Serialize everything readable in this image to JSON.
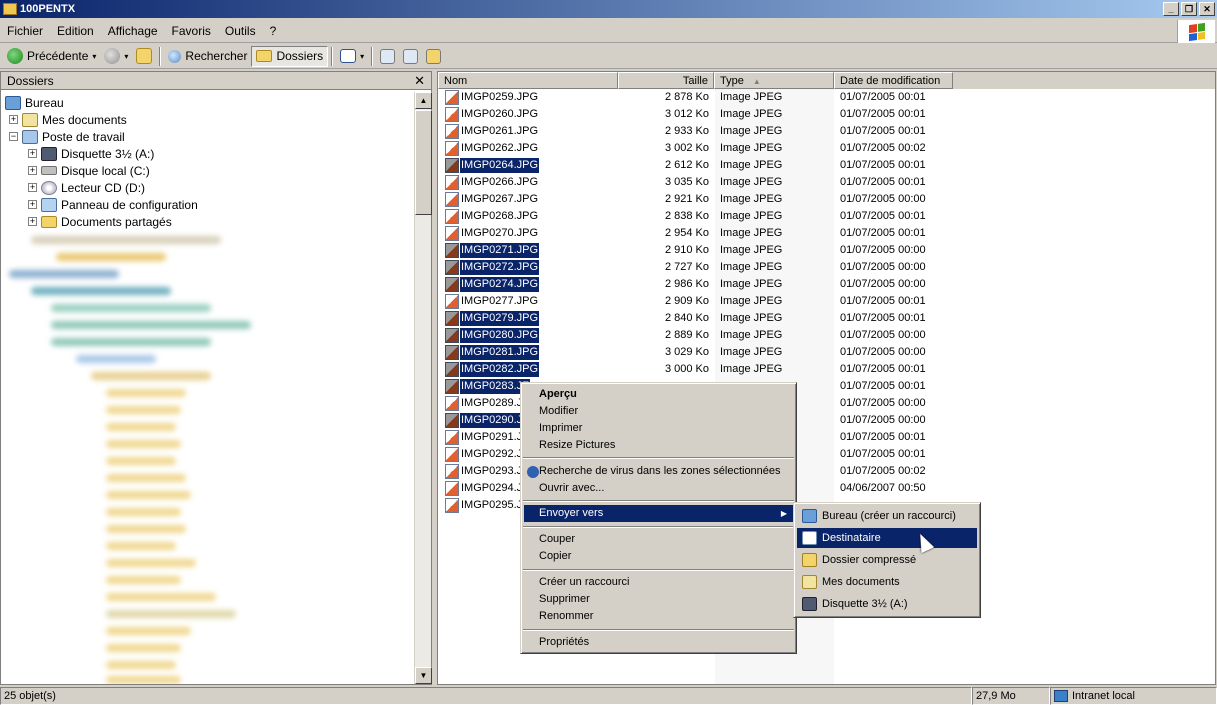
{
  "window": {
    "title": "100PENTX",
    "buttons": {
      "minimize": "_",
      "restore": "❐",
      "close": "✕"
    }
  },
  "menubar": {
    "items": [
      "Fichier",
      "Edition",
      "Affichage",
      "Favoris",
      "Outils",
      "?"
    ]
  },
  "toolbar": {
    "back_label": "Précédente",
    "caret": "▾",
    "search_label": "Rechercher",
    "folders_label": "Dossiers"
  },
  "folders_pane": {
    "title": "Dossiers",
    "close": "✕",
    "tree": [
      {
        "label": "Bureau",
        "icon": "desktop-icon"
      },
      {
        "label": "Mes documents",
        "icon": "my-documents-icon",
        "expander": "+"
      },
      {
        "label": "Poste de travail",
        "icon": "my-computer-icon",
        "expander": "−"
      },
      {
        "label": "Disquette 3½ (A:)",
        "icon": "floppy-icon",
        "expander": "+"
      },
      {
        "label": "Disque local (C:)",
        "icon": "hard-disk-icon",
        "expander": "+"
      },
      {
        "label": "Lecteur CD (D:)",
        "icon": "cd-drive-icon",
        "expander": "+"
      },
      {
        "label": "Panneau de configuration",
        "icon": "control-panel-icon",
        "expander": "+"
      },
      {
        "label": "Documents partagés",
        "icon": "shared-folder-icon",
        "expander": "+"
      }
    ]
  },
  "scroll": {
    "up": "▲",
    "down": "▼"
  },
  "file_list": {
    "columns": {
      "name": "Nom",
      "size": "Taille",
      "type": "Type",
      "sort_arrow": "▲",
      "date": "Date de modification"
    },
    "rows": [
      {
        "name": "IMGP0259.JPG",
        "size": "2 878 Ko",
        "type": "Image JPEG",
        "date": "01/07/2005 00:01",
        "selected": false
      },
      {
        "name": "IMGP0260.JPG",
        "size": "3 012 Ko",
        "type": "Image JPEG",
        "date": "01/07/2005 00:01",
        "selected": false
      },
      {
        "name": "IMGP0261.JPG",
        "size": "2 933 Ko",
        "type": "Image JPEG",
        "date": "01/07/2005 00:01",
        "selected": false
      },
      {
        "name": "IMGP0262.JPG",
        "size": "3 002 Ko",
        "type": "Image JPEG",
        "date": "01/07/2005 00:02",
        "selected": false
      },
      {
        "name": "IMGP0264.JPG",
        "size": "2 612 Ko",
        "type": "Image JPEG",
        "date": "01/07/2005 00:01",
        "selected": true
      },
      {
        "name": "IMGP0266.JPG",
        "size": "3 035 Ko",
        "type": "Image JPEG",
        "date": "01/07/2005 00:01",
        "selected": false
      },
      {
        "name": "IMGP0267.JPG",
        "size": "2 921 Ko",
        "type": "Image JPEG",
        "date": "01/07/2005 00:00",
        "selected": false
      },
      {
        "name": "IMGP0268.JPG",
        "size": "2 838 Ko",
        "type": "Image JPEG",
        "date": "01/07/2005 00:01",
        "selected": false
      },
      {
        "name": "IMGP0270.JPG",
        "size": "2 954 Ko",
        "type": "Image JPEG",
        "date": "01/07/2005 00:01",
        "selected": false
      },
      {
        "name": "IMGP0271.JPG",
        "size": "2 910 Ko",
        "type": "Image JPEG",
        "date": "01/07/2005 00:00",
        "selected": true
      },
      {
        "name": "IMGP0272.JPG",
        "size": "2 727 Ko",
        "type": "Image JPEG",
        "date": "01/07/2005 00:00",
        "selected": true
      },
      {
        "name": "IMGP0274.JPG",
        "size": "2 986 Ko",
        "type": "Image JPEG",
        "date": "01/07/2005 00:00",
        "selected": true
      },
      {
        "name": "IMGP0277.JPG",
        "size": "2 909 Ko",
        "type": "Image JPEG",
        "date": "01/07/2005 00:01",
        "selected": false
      },
      {
        "name": "IMGP0279.JPG",
        "size": "2 840 Ko",
        "type": "Image JPEG",
        "date": "01/07/2005 00:01",
        "selected": true
      },
      {
        "name": "IMGP0280.JPG",
        "size": "2 889 Ko",
        "type": "Image JPEG",
        "date": "01/07/2005 00:00",
        "selected": true
      },
      {
        "name": "IMGP0281.JPG",
        "size": "3 029 Ko",
        "type": "Image JPEG",
        "date": "01/07/2005 00:00",
        "selected": true
      },
      {
        "name": "IMGP0282.JPG",
        "size": "3 000 Ko",
        "type": "Image JPEG",
        "date": "01/07/2005 00:01",
        "selected": true
      },
      {
        "name": "IMGP0283.JF",
        "size": "",
        "type": "",
        "date": "01/07/2005 00:01",
        "selected": true
      },
      {
        "name": "IMGP0289.JF",
        "size": "",
        "type": "",
        "date": "01/07/2005 00:00",
        "selected": false
      },
      {
        "name": "IMGP0290.JF",
        "size": "",
        "type": "",
        "date": "01/07/2005 00:00",
        "selected": true
      },
      {
        "name": "IMGP0291.JF",
        "size": "",
        "type": "",
        "date": "01/07/2005 00:01",
        "selected": false
      },
      {
        "name": "IMGP0292.JF",
        "size": "",
        "type": "",
        "date": "01/07/2005 00:01",
        "selected": false
      },
      {
        "name": "IMGP0293.JF",
        "size": "",
        "type": "",
        "date": "01/07/2005 00:02",
        "selected": false
      },
      {
        "name": "IMGP0294.JF",
        "size": "",
        "type": "",
        "date": "04/06/2007 00:50",
        "selected": false
      },
      {
        "name": "IMGP0295.JF",
        "size": "",
        "type": "",
        "date": "",
        "selected": false
      }
    ]
  },
  "context_menu": {
    "items": [
      "Aperçu",
      "Modifier",
      "Imprimer",
      "Resize Pictures",
      "Recherche de virus dans les zones sélectionnées",
      "Ouvrir avec...",
      "Envoyer vers",
      "Couper",
      "Copier",
      "Créer un raccourci",
      "Supprimer",
      "Renommer",
      "Propriétés"
    ],
    "submenu_arrow": "▶"
  },
  "send_to_submenu": {
    "items": [
      "Bureau (créer un raccourci)",
      "Destinataire",
      "Dossier compressé",
      "Mes documents",
      "Disquette 3½ (A:)"
    ]
  },
  "statusbar": {
    "objects": "25 objet(s)",
    "size": "27,9 Mo",
    "zone": "Intranet local"
  },
  "colors": {
    "selection": "#0a246a",
    "chrome": "#d4d0c8",
    "title_gradient_start": "#0a246a",
    "title_gradient_end": "#a6caf0"
  }
}
